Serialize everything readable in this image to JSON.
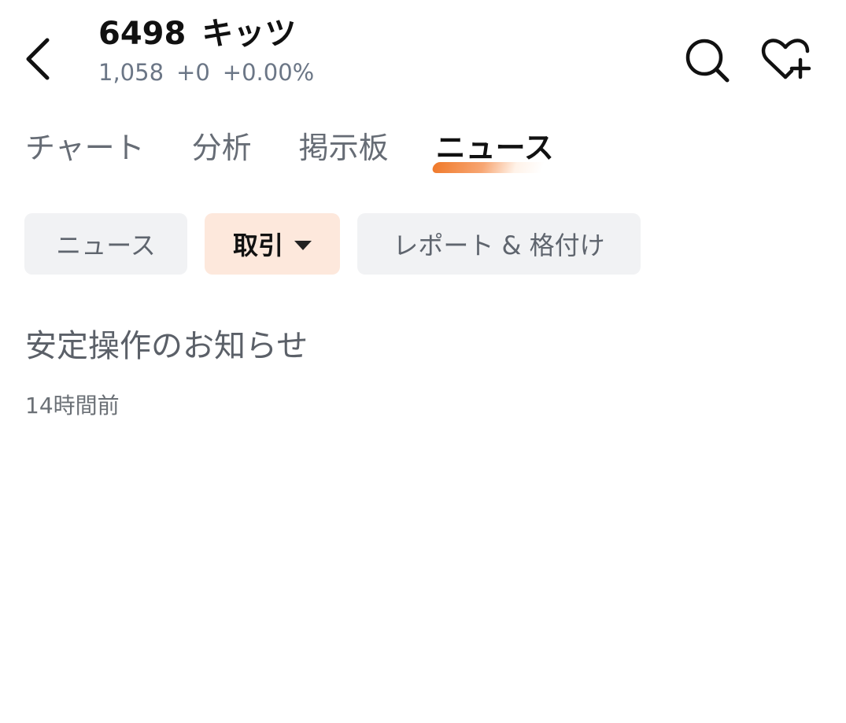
{
  "header": {
    "code": "6498",
    "name": "キッツ",
    "price": "1,058",
    "change": "+0",
    "change_pct": "+0.00%",
    "back_icon": "chevron-left-icon",
    "search_icon": "search-icon",
    "favorite_icon": "heart-plus-icon"
  },
  "tabs": [
    {
      "label": "チャート",
      "active": false
    },
    {
      "label": "分析",
      "active": false
    },
    {
      "label": "掲示板",
      "active": false
    },
    {
      "label": "ニュース",
      "active": true
    }
  ],
  "filters": [
    {
      "label": "ニュース",
      "active": false
    },
    {
      "label": "取引",
      "active": true,
      "icon": "caret-down-icon"
    },
    {
      "label": "レポート & 格付け",
      "active": false
    }
  ],
  "news": [
    {
      "title": "安定操作のお知らせ",
      "time": "14時間前"
    }
  ],
  "colors": {
    "accent": "#f07a2b",
    "active_chip_bg": "#fde8dc",
    "chip_bg": "#f1f2f4",
    "muted_text": "#6b7686"
  }
}
